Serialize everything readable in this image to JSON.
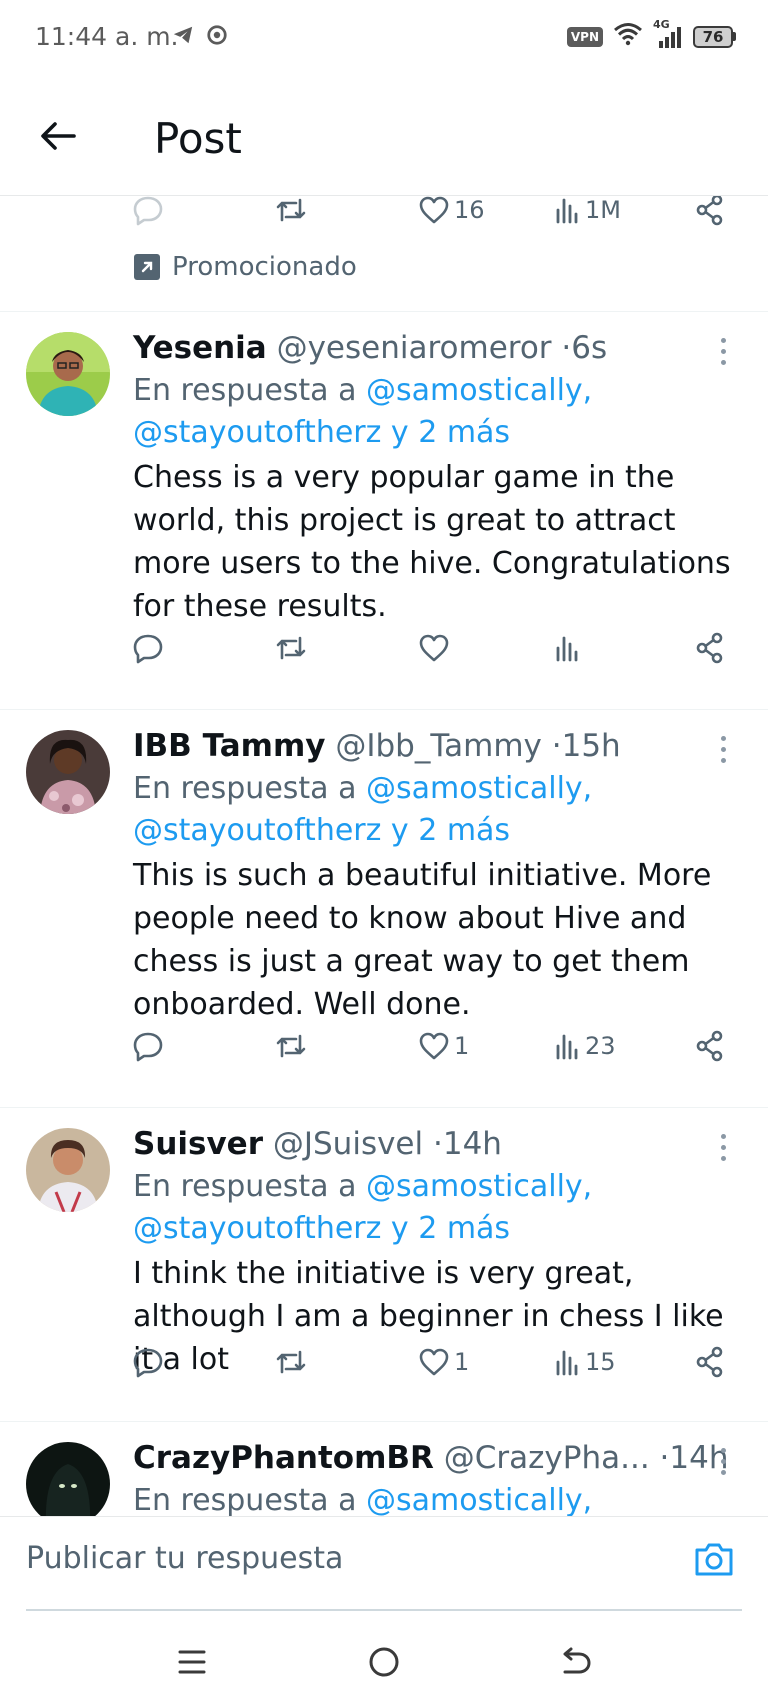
{
  "status_bar": {
    "time": "11:44 a. m.",
    "vpn": "VPN",
    "network": "4G",
    "battery": "76"
  },
  "header": {
    "title": "Post"
  },
  "promoted": {
    "label": "Promocionado",
    "likes": "16",
    "views": "1M"
  },
  "tweets": [
    {
      "name": "Yesenia",
      "handle": "@yeseniaromeror",
      "time": "6s",
      "reply_prefix": "En respuesta a",
      "reply_mention1": "@samostically,",
      "reply_mention2": "@stayoutoftherz y 2 más",
      "text": "Chess is a very popular game in the world, this project is great to attract more users to the hive. Congratulations for these results.",
      "likes": "",
      "views": ""
    },
    {
      "name": "IBB Tammy",
      "handle": "@Ibb_Tammy",
      "time": "15h",
      "reply_prefix": "En respuesta a",
      "reply_mention1": "@samostically,",
      "reply_mention2": "@stayoutoftherz y 2 más",
      "text": "This is such a beautiful initiative. More people need to know about Hive and chess is just a great way to get them onboarded. Well done.",
      "likes": "1",
      "views": "23"
    },
    {
      "name": "Suisver",
      "handle": "@JSuisvel",
      "time": "14h",
      "reply_prefix": "En respuesta a",
      "reply_mention1": "@samostically,",
      "reply_mention2": "@stayoutoftherz y 2 más",
      "text": "I think the initiative is very great, although I am a beginner in chess I like it a lot",
      "likes": "1",
      "views": "15"
    },
    {
      "name": "CrazyPhantomBR",
      "handle": "@CrazyPha...",
      "time": "14h",
      "reply_prefix": "En respuesta a",
      "reply_mention1": "@samostically,",
      "reply_mention2": "",
      "text": "",
      "likes": "",
      "views": ""
    }
  ],
  "composer": {
    "placeholder": "Publicar tu respuesta"
  },
  "colors": {
    "accent": "#1d9bf0",
    "secondary_text": "#536471",
    "primary_text": "#0f1419",
    "divider": "#eff3f4"
  }
}
